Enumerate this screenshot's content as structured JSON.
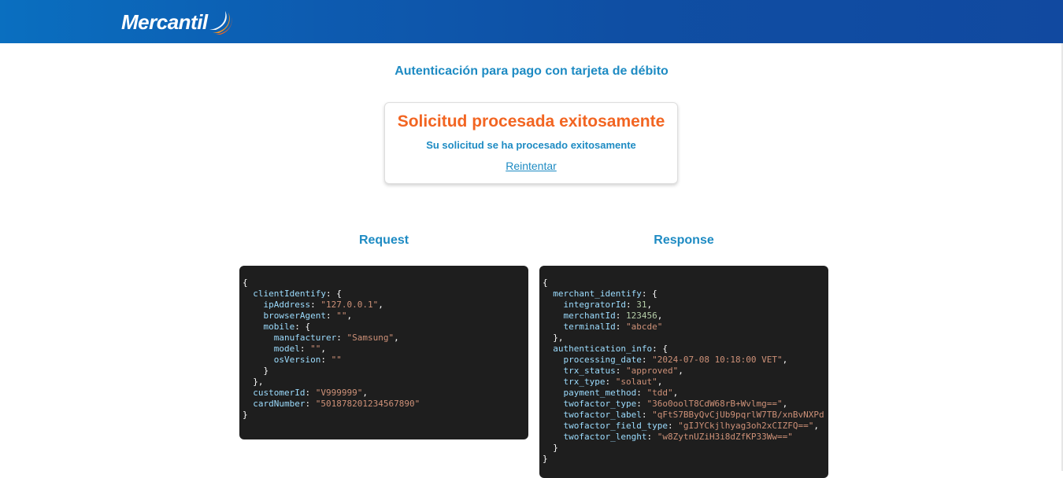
{
  "header": {
    "logo_text": "Mercantil"
  },
  "page": {
    "title": "Autenticación para pago con tarjeta de débito"
  },
  "result_card": {
    "title": "Solicitud procesada exitosamente",
    "message": "Su solicitud se ha procesado exitosamente",
    "retry_link": "Reintentar"
  },
  "request": {
    "title": "Request",
    "lines": [
      {
        "indent": 0,
        "parts": [
          [
            "p",
            "{"
          ]
        ]
      },
      {
        "indent": 1,
        "parts": [
          [
            "k",
            "clientIdentify"
          ],
          [
            "p",
            ": {"
          ]
        ]
      },
      {
        "indent": 2,
        "parts": [
          [
            "k",
            "ipAddress"
          ],
          [
            "p",
            ": "
          ],
          [
            "s",
            "\"127.0.0.1\""
          ],
          [
            "p",
            ","
          ]
        ]
      },
      {
        "indent": 2,
        "parts": [
          [
            "k",
            "browserAgent"
          ],
          [
            "p",
            ": "
          ],
          [
            "s",
            "\"\""
          ],
          [
            "p",
            ","
          ]
        ]
      },
      {
        "indent": 2,
        "parts": [
          [
            "k",
            "mobile"
          ],
          [
            "p",
            ": {"
          ]
        ]
      },
      {
        "indent": 3,
        "parts": [
          [
            "k",
            "manufacturer"
          ],
          [
            "p",
            ": "
          ],
          [
            "s",
            "\"Samsung\""
          ],
          [
            "p",
            ","
          ]
        ]
      },
      {
        "indent": 3,
        "parts": [
          [
            "k",
            "model"
          ],
          [
            "p",
            ": "
          ],
          [
            "s",
            "\"\""
          ],
          [
            "p",
            ","
          ]
        ]
      },
      {
        "indent": 3,
        "parts": [
          [
            "k",
            "osVersion"
          ],
          [
            "p",
            ": "
          ],
          [
            "s",
            "\"\""
          ]
        ]
      },
      {
        "indent": 2,
        "parts": [
          [
            "p",
            "}"
          ]
        ]
      },
      {
        "indent": 1,
        "parts": [
          [
            "p",
            "},"
          ]
        ]
      },
      {
        "indent": 1,
        "parts": [
          [
            "k",
            "customerId"
          ],
          [
            "p",
            ": "
          ],
          [
            "s",
            "\"V999999\""
          ],
          [
            "p",
            ","
          ]
        ]
      },
      {
        "indent": 1,
        "parts": [
          [
            "k",
            "cardNumber"
          ],
          [
            "p",
            ": "
          ],
          [
            "s",
            "\"501878201234567890\""
          ]
        ]
      },
      {
        "indent": 0,
        "parts": [
          [
            "p",
            "}"
          ]
        ]
      }
    ]
  },
  "response": {
    "title": "Response",
    "lines": [
      {
        "indent": 0,
        "parts": [
          [
            "p",
            "{"
          ]
        ]
      },
      {
        "indent": 1,
        "parts": [
          [
            "k",
            "merchant_identify"
          ],
          [
            "p",
            ": {"
          ]
        ]
      },
      {
        "indent": 2,
        "parts": [
          [
            "k",
            "integratorId"
          ],
          [
            "p",
            ": "
          ],
          [
            "n",
            "31"
          ],
          [
            "p",
            ","
          ]
        ]
      },
      {
        "indent": 2,
        "parts": [
          [
            "k",
            "merchantId"
          ],
          [
            "p",
            ": "
          ],
          [
            "n",
            "123456"
          ],
          [
            "p",
            ","
          ]
        ]
      },
      {
        "indent": 2,
        "parts": [
          [
            "k",
            "terminalId"
          ],
          [
            "p",
            ": "
          ],
          [
            "s",
            "\"abcde\""
          ]
        ]
      },
      {
        "indent": 1,
        "parts": [
          [
            "p",
            "},"
          ]
        ]
      },
      {
        "indent": 1,
        "parts": [
          [
            "k",
            "authentication_info"
          ],
          [
            "p",
            ": {"
          ]
        ]
      },
      {
        "indent": 2,
        "parts": [
          [
            "k",
            "processing_date"
          ],
          [
            "p",
            ": "
          ],
          [
            "s",
            "\"2024-07-08 10:18:00 VET\""
          ],
          [
            "p",
            ","
          ]
        ]
      },
      {
        "indent": 2,
        "parts": [
          [
            "k",
            "trx_status"
          ],
          [
            "p",
            ": "
          ],
          [
            "s",
            "\"approved\""
          ],
          [
            "p",
            ","
          ]
        ]
      },
      {
        "indent": 2,
        "parts": [
          [
            "k",
            "trx_type"
          ],
          [
            "p",
            ": "
          ],
          [
            "s",
            "\"solaut\""
          ],
          [
            "p",
            ","
          ]
        ]
      },
      {
        "indent": 2,
        "parts": [
          [
            "k",
            "payment_method"
          ],
          [
            "p",
            ": "
          ],
          [
            "s",
            "\"tdd\""
          ],
          [
            "p",
            ","
          ]
        ]
      },
      {
        "indent": 2,
        "parts": [
          [
            "k",
            "twofactor_type"
          ],
          [
            "p",
            ": "
          ],
          [
            "s",
            "\"36o0oolT8CdW68rB+Wvlmg==\""
          ],
          [
            "p",
            ","
          ]
        ]
      },
      {
        "indent": 2,
        "parts": [
          [
            "k",
            "twofactor_label"
          ],
          [
            "p",
            ": "
          ],
          [
            "s",
            "\"qFtS7BByQvCjUb9pqrlW7TB/xnBvNXPd"
          ]
        ]
      },
      {
        "indent": 2,
        "parts": [
          [
            "k",
            "twofactor_field_type"
          ],
          [
            "p",
            ": "
          ],
          [
            "s",
            "\"gIJYCkjlhyag3oh2xCIZFQ==\""
          ],
          [
            "p",
            ","
          ]
        ]
      },
      {
        "indent": 2,
        "parts": [
          [
            "k",
            "twofactor_lenght"
          ],
          [
            "p",
            ": "
          ],
          [
            "s",
            "\"w8ZytnUZiH3i8dZfKP33Ww==\""
          ]
        ]
      },
      {
        "indent": 1,
        "parts": [
          [
            "p",
            "}"
          ]
        ]
      },
      {
        "indent": 0,
        "parts": [
          [
            "p",
            "}"
          ]
        ]
      }
    ]
  },
  "colors": {
    "header": "#0d5bb0",
    "accent_blue": "#1e8bc3",
    "success_orange": "#f26522",
    "code_bg": "#1e1e1e",
    "code_key": "#9cdcfe",
    "code_string": "#ce9178",
    "code_number": "#b5cea8"
  }
}
